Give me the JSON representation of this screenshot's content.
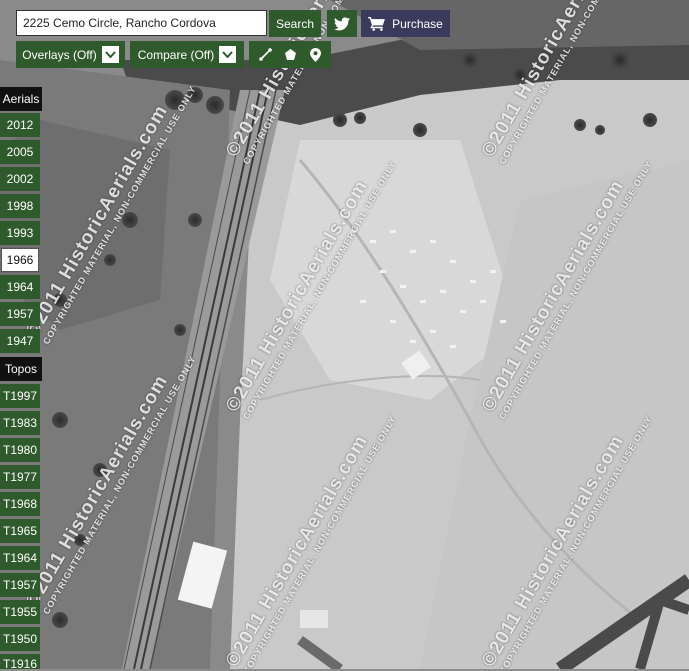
{
  "search": {
    "value": "2225 Cemo Circle, Rancho Cordova",
    "button_label": "Search"
  },
  "share": {
    "icon": "twitter-icon"
  },
  "purchase": {
    "label": "Purchase",
    "icon": "cart-icon"
  },
  "toolbar": {
    "overlays_label": "Overlays (Off)",
    "compare_label": "Compare (Off)",
    "tools": [
      "measure-line-icon",
      "polygon-icon",
      "map-pin-icon"
    ]
  },
  "aerials": {
    "heading": "Aerials",
    "selected": "1966",
    "years": [
      "2012",
      "2005",
      "2002",
      "1998",
      "1993",
      "1966",
      "1964",
      "1957",
      "1947"
    ]
  },
  "topos": {
    "heading": "Topos",
    "years": [
      "T1997",
      "T1983",
      "T1980",
      "T1977",
      "T1968",
      "T1965",
      "T1964",
      "T1957",
      "T1955",
      "T1950",
      "T1916"
    ]
  },
  "watermark": {
    "brand": "©2011 HistoricAerials.com",
    "notice": "COPYRIGHTED MATERIAL, NON-COMMERCIAL USE ONLY"
  },
  "colors": {
    "button_bg": "#2f5a2c",
    "purchase_bg": "#3a3a5c",
    "map_base": "#8d8d8d"
  }
}
